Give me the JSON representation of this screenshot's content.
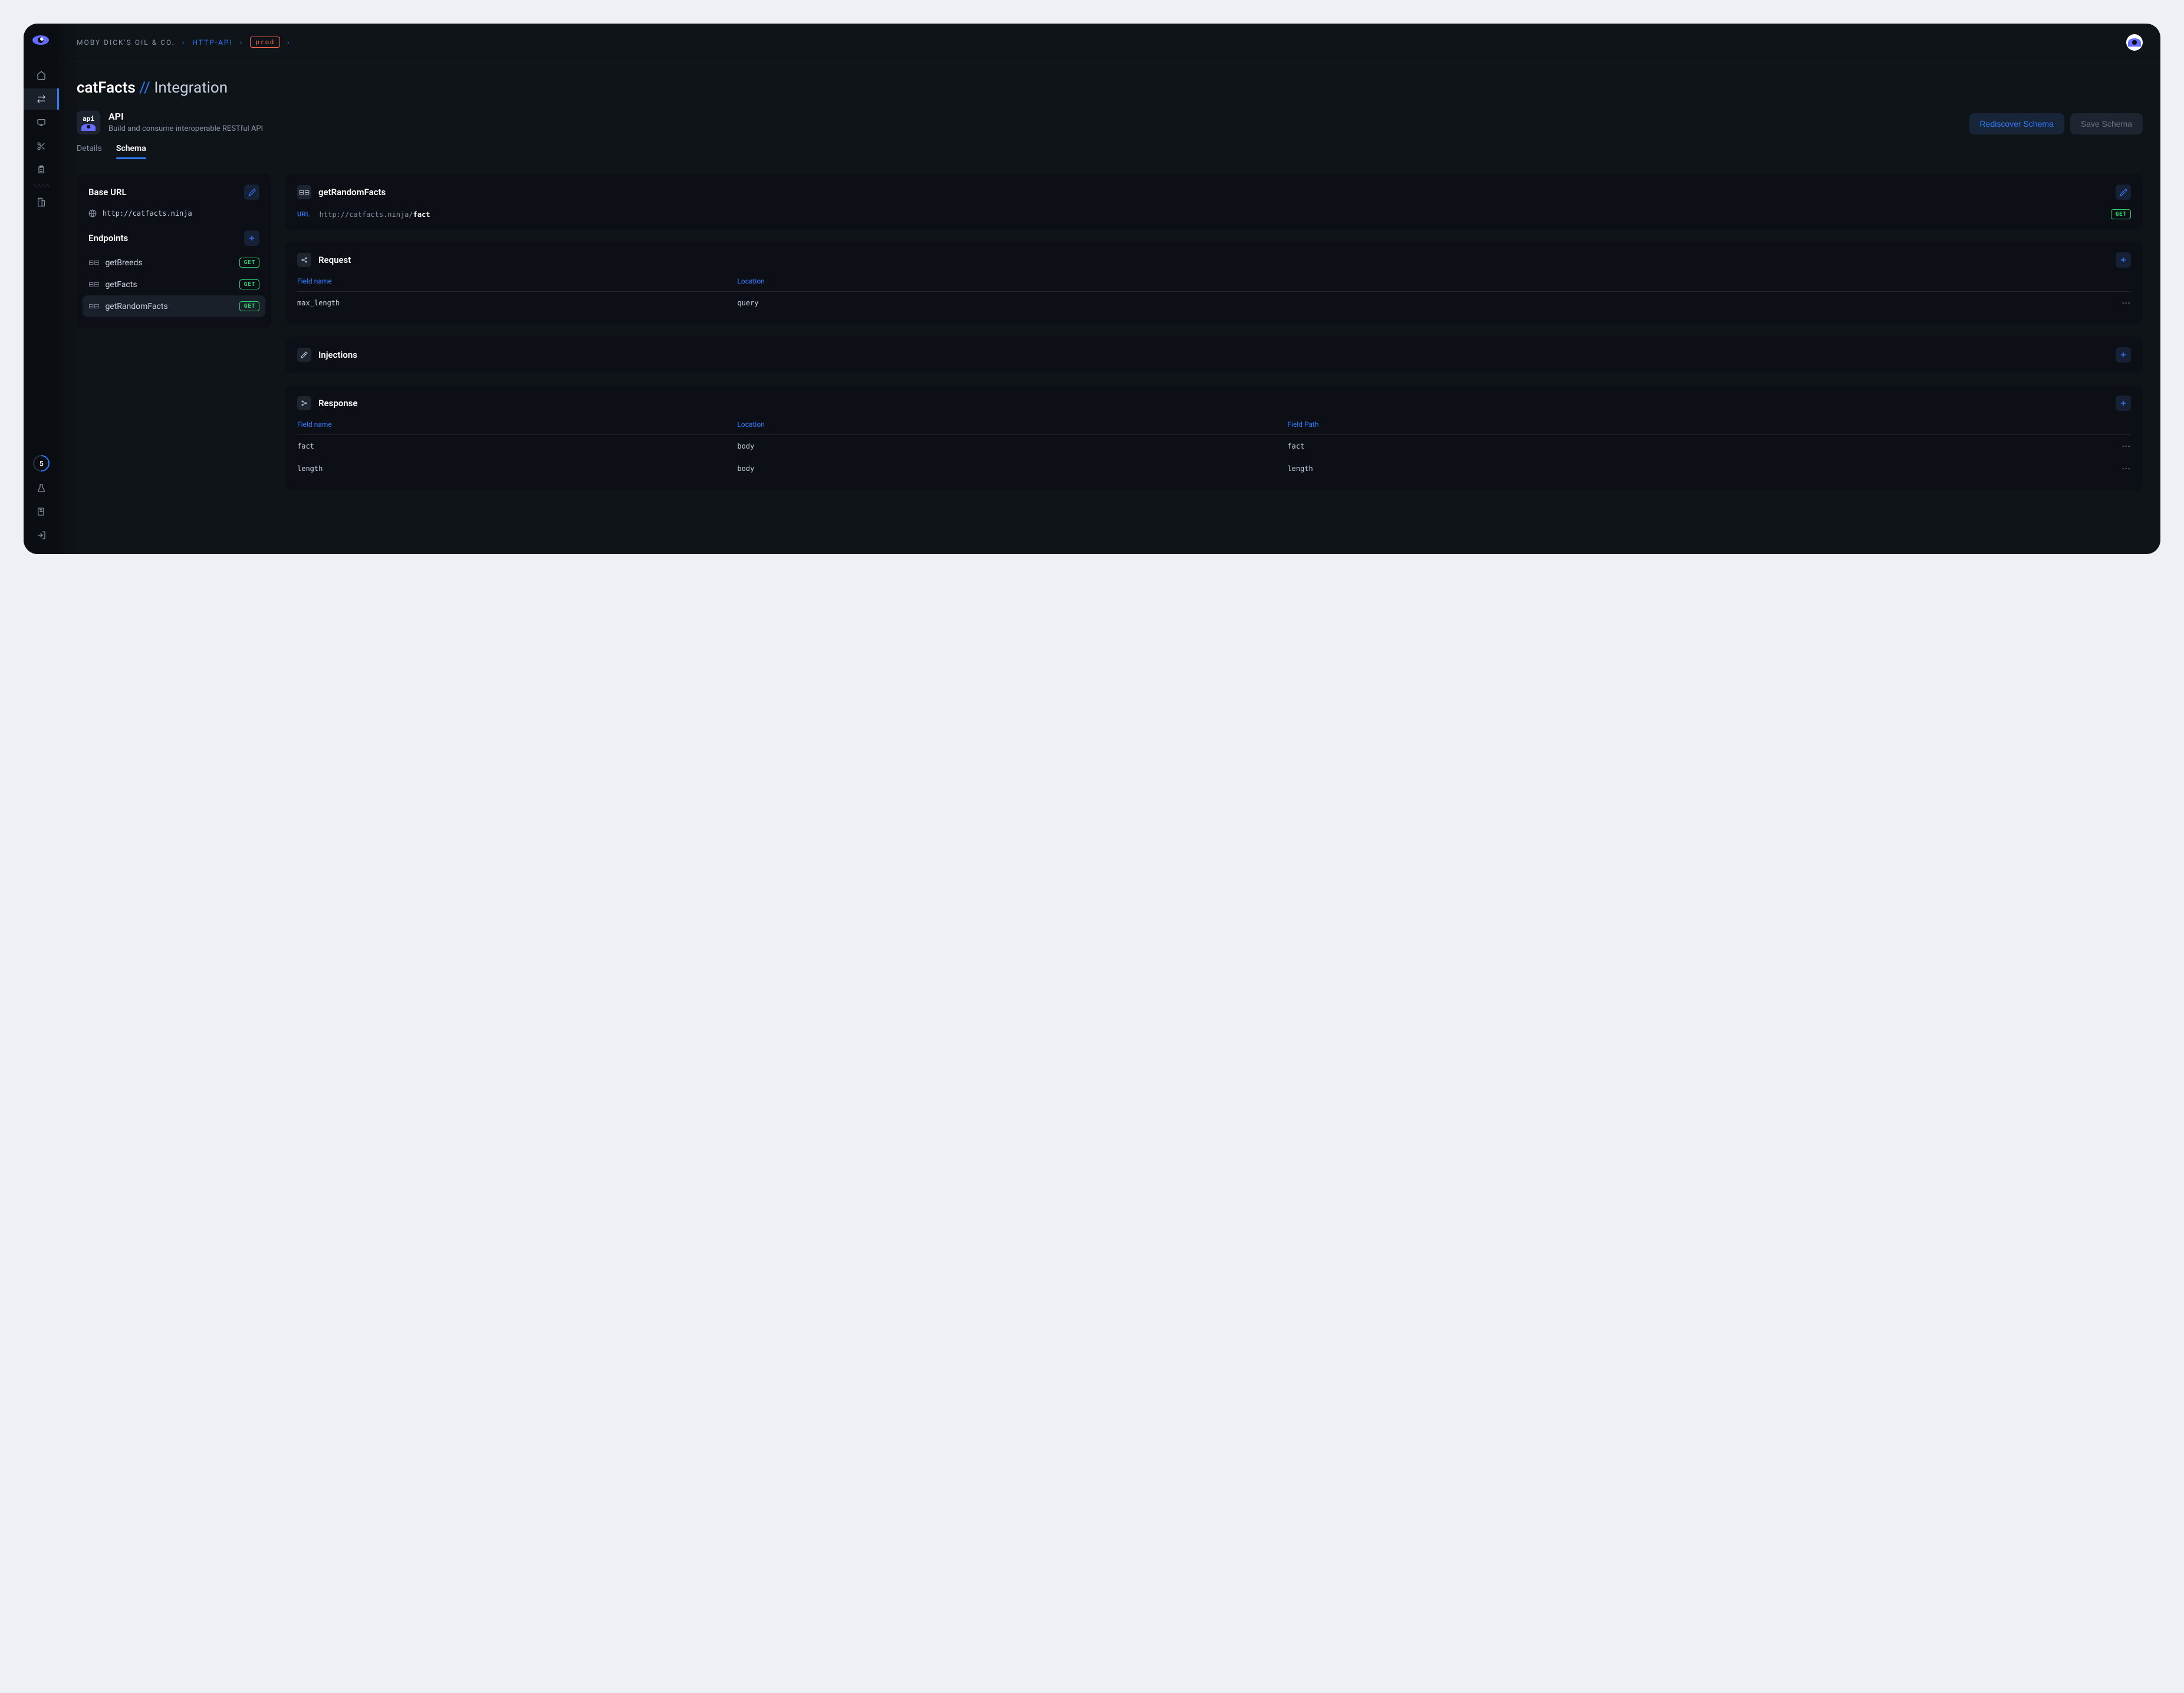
{
  "breadcrumb": {
    "org": "MOBY DICK'S OIL & CO.",
    "project": "HTTP-API",
    "env": "prod"
  },
  "page": {
    "title_main": "catFacts",
    "title_sep": "//",
    "title_sub": "Integration"
  },
  "api_block": {
    "icon_label": "api",
    "title": "API",
    "description": "Build and consume interoperable RESTful API"
  },
  "actions": {
    "rediscover": "Rediscover Schema",
    "save": "Save Schema"
  },
  "tabs": {
    "details": "Details",
    "schema": "Schema"
  },
  "base_url_card": {
    "title": "Base URL",
    "url": "http://catfacts.ninja"
  },
  "endpoints": {
    "title": "Endpoints",
    "items": [
      {
        "name": "getBreeds",
        "method": "GET",
        "selected": false
      },
      {
        "name": "getFacts",
        "method": "GET",
        "selected": false
      },
      {
        "name": "getRandomFacts",
        "method": "GET",
        "selected": true
      }
    ]
  },
  "endpoint_detail": {
    "name": "getRandomFacts",
    "url_label": "URL",
    "url_base": "http://catfacts.ninja/",
    "url_path": "fact",
    "method": "GET"
  },
  "request": {
    "title": "Request",
    "columns": {
      "field": "Field name",
      "location": "Location"
    },
    "rows": [
      {
        "field": "max_length",
        "location": "query"
      }
    ]
  },
  "injections": {
    "title": "Injections"
  },
  "response": {
    "title": "Response",
    "columns": {
      "field": "Field name",
      "location": "Location",
      "path": "Field Path"
    },
    "rows": [
      {
        "field": "fact",
        "location": "body",
        "path": "fact"
      },
      {
        "field": "length",
        "location": "body",
        "path": "length"
      }
    ]
  },
  "usage": {
    "count": "5"
  }
}
